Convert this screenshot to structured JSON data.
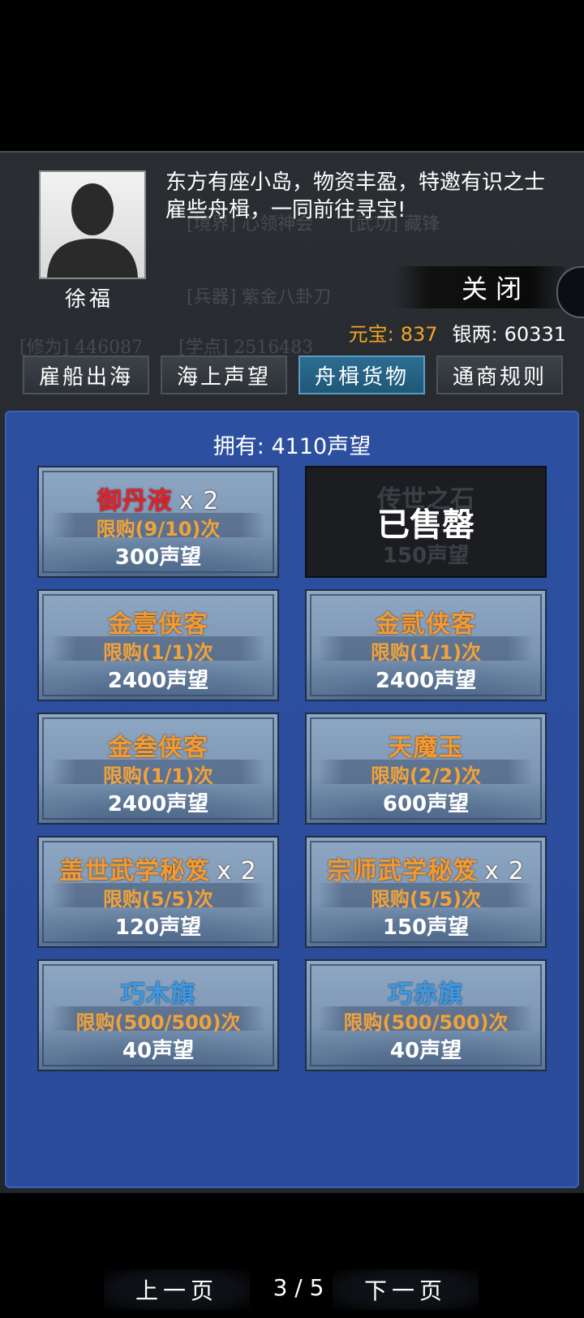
{
  "npc": {
    "name": "徐福",
    "dialog": "东方有座小岛，物资丰盈，特邀有识之士雇些舟楫，一同前往寻宝!"
  },
  "close_label": "关闭",
  "currency": {
    "yuanbao_label": "元宝:",
    "yuanbao_value": "837",
    "silver_label": "银两:",
    "silver_value": "60331"
  },
  "tabs": [
    {
      "label": "雇船出海",
      "active": false
    },
    {
      "label": "海上声望",
      "active": false
    },
    {
      "label": "舟楫货物",
      "active": true
    },
    {
      "label": "通商规则",
      "active": false
    }
  ],
  "shop": {
    "owned": "拥有: 4110声望",
    "items": [
      {
        "name": "御丹液",
        "qty": "x 2",
        "limit": "限购(9/10)次",
        "price": "300声望",
        "color": "#e3222b"
      },
      {
        "name": "",
        "qty": "",
        "limit": "",
        "price": "150声望",
        "soldout": "已售罄"
      },
      {
        "name": "金壹侠客",
        "qty": "",
        "limit": "限购(1/1)次",
        "price": "2400声望",
        "color": "#f39a33"
      },
      {
        "name": "金贰侠客",
        "qty": "",
        "limit": "限购(1/1)次",
        "price": "2400声望",
        "color": "#f39a33"
      },
      {
        "name": "金叁侠客",
        "qty": "",
        "limit": "限购(1/1)次",
        "price": "2400声望",
        "color": "#f39a33"
      },
      {
        "name": "天魔玉",
        "qty": "",
        "limit": "限购(2/2)次",
        "price": "600声望",
        "color": "#f39a33"
      },
      {
        "name": "盖世武学秘笈",
        "qty": "x 2",
        "limit": "限购(5/5)次",
        "price": "120声望",
        "color": "#f39a33"
      },
      {
        "name": "宗师武学秘笈",
        "qty": "x 2",
        "limit": "限购(5/5)次",
        "price": "150声望",
        "color": "#f39a33"
      },
      {
        "name": "巧木旗",
        "qty": "",
        "limit": "限购(500/500)次",
        "price": "40声望",
        "color": "#3c9ae3"
      },
      {
        "name": "巧赤旗",
        "qty": "",
        "limit": "限购(500/500)次",
        "price": "40声望",
        "color": "#3c9ae3"
      }
    ]
  },
  "pager": {
    "prev": "上一页",
    "page": "3 / 5",
    "next": "下一页"
  }
}
